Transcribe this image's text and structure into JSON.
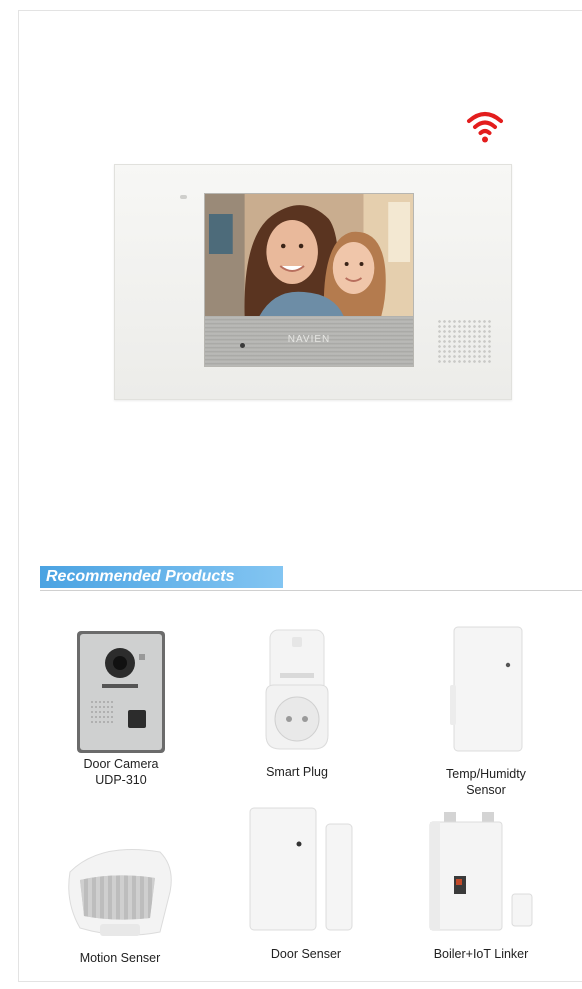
{
  "section": {
    "title": "Recommended Products"
  },
  "hero": {
    "brand": "NAVIEN"
  },
  "products": [
    {
      "line1": "Door Camera",
      "line2": "UDP-310"
    },
    {
      "line1": "Smart Plug"
    },
    {
      "line1": "Temp/Humidty",
      "line2": "Sensor"
    },
    {
      "line1": "Motion Senser"
    },
    {
      "line1": "Door Senser"
    },
    {
      "line1": "Boiler+IoT Linker"
    }
  ],
  "colors": {
    "accent": "#4ba3e2",
    "wifi": "#e31d1d"
  },
  "icons": {
    "wifi": "wifi-icon"
  }
}
